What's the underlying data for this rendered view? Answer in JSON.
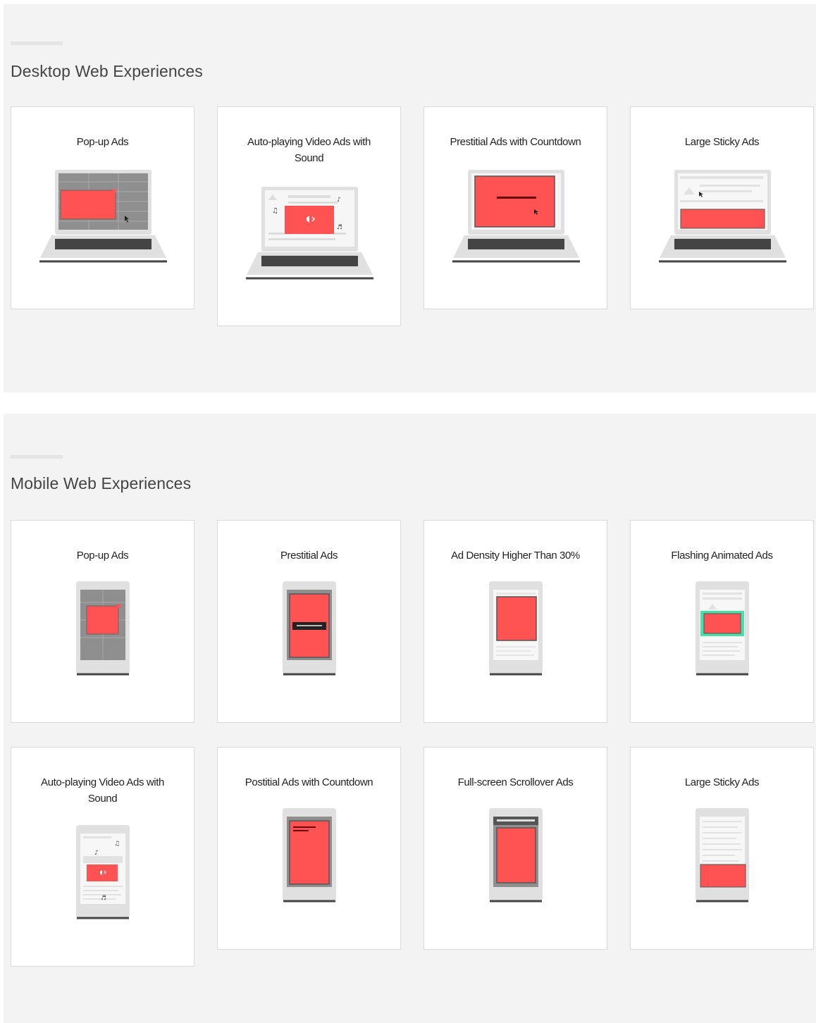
{
  "sections": [
    {
      "title": "Desktop Web Experiences",
      "cards": [
        {
          "title": "Pop-up Ads",
          "illustration": "laptop-popup-ad"
        },
        {
          "title": "Auto-playing Video Ads with Sound",
          "illustration": "laptop-autoplay-video-ad"
        },
        {
          "title": "Prestitial Ads with Countdown",
          "illustration": "laptop-prestitial-countdown-ad"
        },
        {
          "title": "Large Sticky Ads",
          "illustration": "laptop-large-sticky-ad"
        }
      ]
    },
    {
      "title": "Mobile Web Experiences",
      "cards": [
        {
          "title": "Pop-up Ads",
          "illustration": "phone-popup-ad"
        },
        {
          "title": "Prestitial Ads",
          "illustration": "phone-prestitial-ad"
        },
        {
          "title": "Ad Density Higher Than 30%",
          "illustration": "phone-ad-density"
        },
        {
          "title": "Flashing Animated Ads",
          "illustration": "phone-flashing-animated-ad"
        },
        {
          "title": "Auto-playing Video Ads with Sound",
          "illustration": "phone-autoplay-video-ad"
        },
        {
          "title": "Postitial Ads with Countdown",
          "illustration": "phone-postitial-countdown-ad"
        },
        {
          "title": "Full-screen Scrollover Ads",
          "illustration": "phone-fullscreen-scrollover-ad"
        },
        {
          "title": "Large Sticky Ads",
          "illustration": "phone-large-sticky-ad"
        }
      ]
    }
  ],
  "colors": {
    "ad_red": "#ff5252",
    "flash_green": "#46e0a8",
    "device_gray": "#e0e0e0",
    "dark": "#333333",
    "section_bg": "#f3f3f3"
  }
}
